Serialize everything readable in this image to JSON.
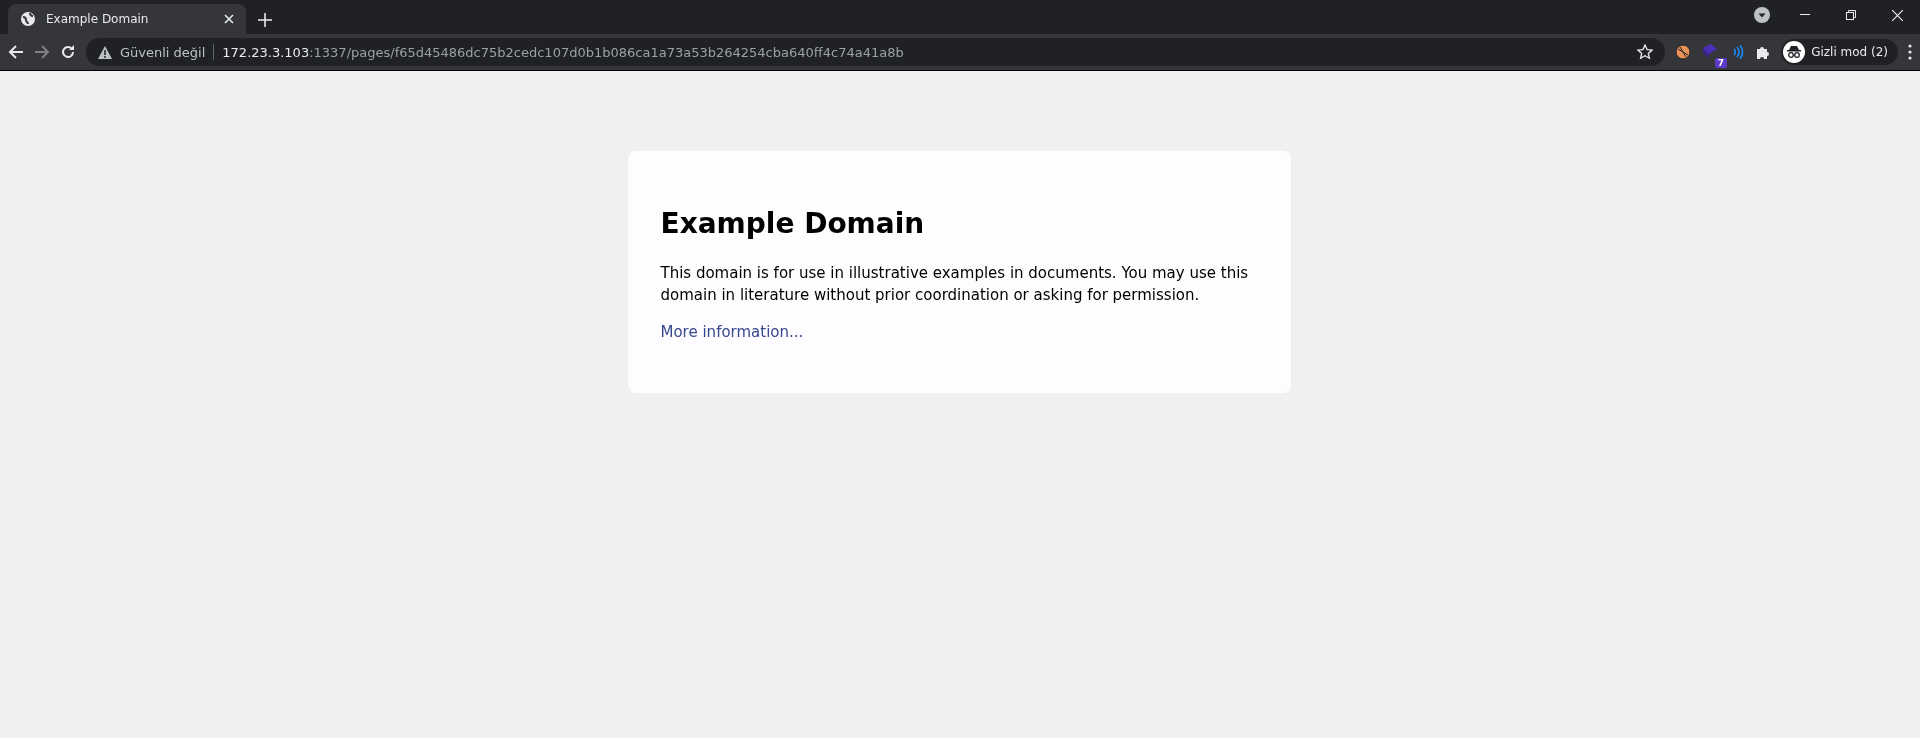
{
  "tabs": [
    {
      "title": "Example Domain",
      "selected": true
    }
  ],
  "toolbar": {
    "security_label": "Güvenli değil",
    "url_host": "172.23.3.103",
    "url_rest": ":1337/pages/f65d45486dc75b2cedc107d0b1b086ca1a73a53b264254cba640ff4c74a41a8b",
    "extension_badge": "7",
    "profile_label": "Gizli mod (2)"
  },
  "page": {
    "heading": "Example Domain",
    "paragraph": "This domain is for use in illustrative examples in documents. You may use this domain in literature without prior coordination or asking for permission.",
    "link": "More information..."
  }
}
